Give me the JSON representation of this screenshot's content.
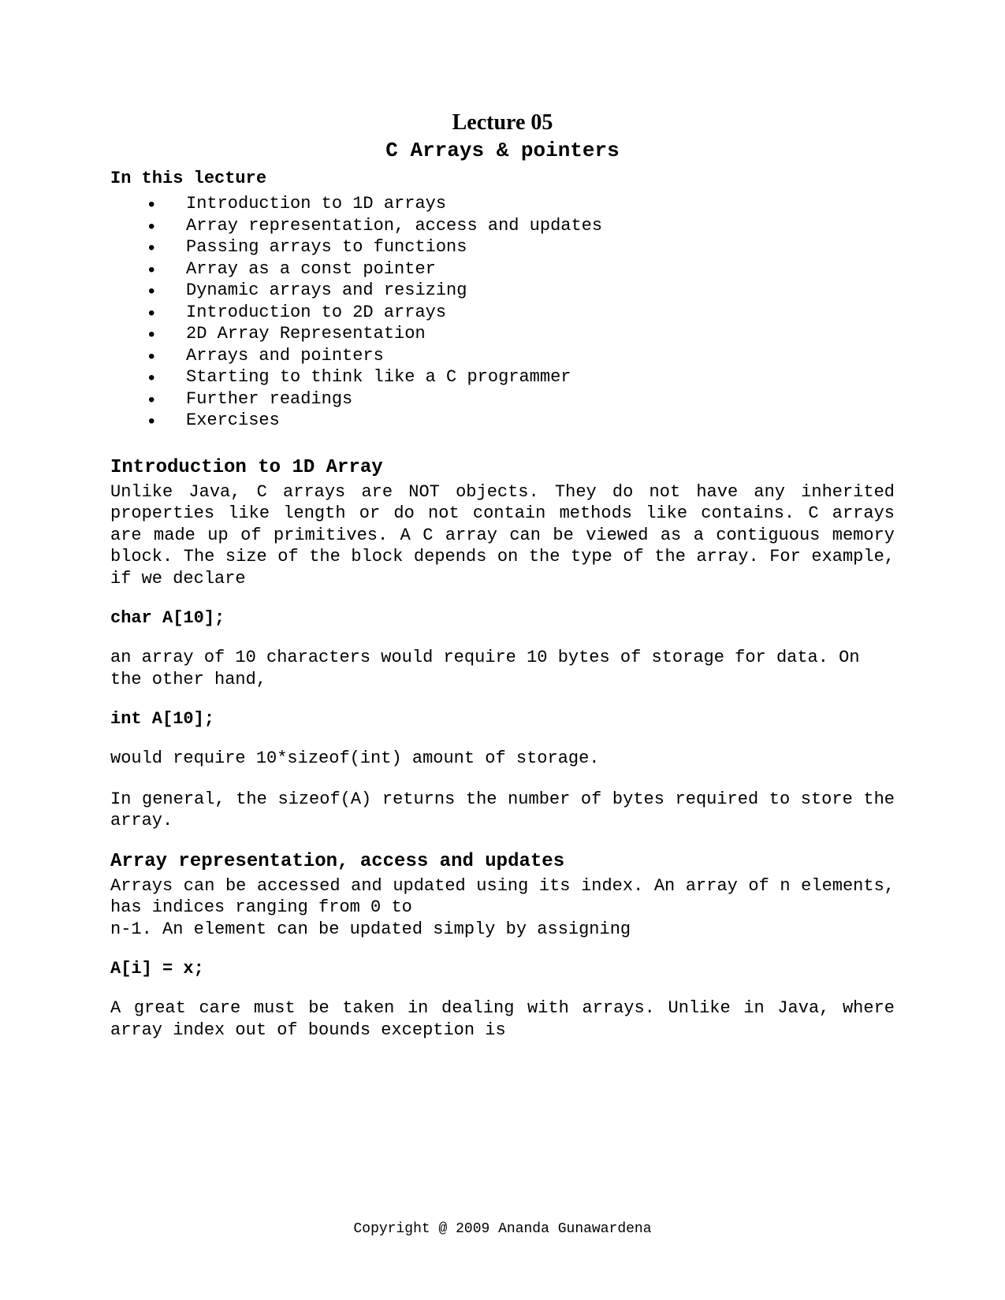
{
  "title_main": "Lecture 05",
  "title_sub": "C Arrays & pointers",
  "section_label": "In this lecture",
  "bullets": [
    "Introduction to 1D arrays",
    "Array representation, access and updates",
    "Passing arrays to functions",
    "Array as a const pointer",
    "Dynamic arrays and resizing",
    "Introduction to 2D arrays",
    "2D Array Representation",
    "Arrays and pointers",
    "Starting to think like a C programmer",
    "Further readings",
    "Exercises"
  ],
  "heading1": "Introduction to 1D Array",
  "para1": "Unlike Java, C arrays are NOT objects. They do not have any inherited properties like length or do not contain methods like contains. C arrays are made up of primitives. A C array can be viewed as a contiguous memory block. The size of the block depends on the type of the array. For example, if we declare",
  "code1": "char A[10];",
  "para2": "an array of 10 characters would require 10 bytes of storage for data. On the other hand,",
  "code2": "int A[10];",
  "para3": "would require 10*sizeof(int) amount of storage.",
  "para4": "In general, the sizeof(A) returns the number of bytes required to store the array.",
  "heading2": "Array representation, access and updates",
  "para5_line1": "Arrays can be accessed and updated using its index. An array of n elements, has indices ranging from 0 to",
  "para5_line2": "n-1. An element can be updated simply by assigning",
  "code3": "A[i] = x;",
  "para6": "A great care must be taken in dealing with arrays. Unlike in Java, where array index out of bounds exception is",
  "footer": "Copyright @ 2009 Ananda Gunawardena"
}
